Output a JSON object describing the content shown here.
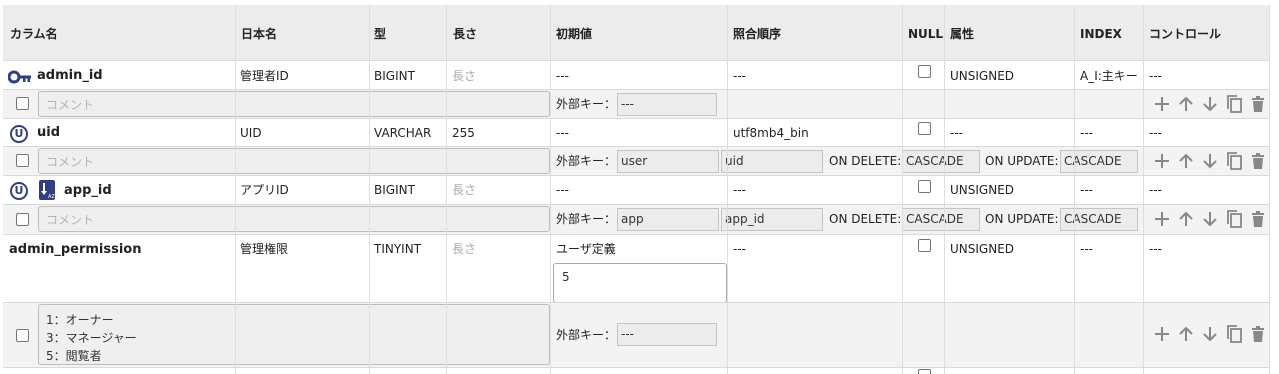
{
  "headers": {
    "column": "カラム名",
    "japanese": "日本名",
    "type": "型",
    "length": "長さ",
    "default": "初期値",
    "collation": "照合順序",
    "null": "NULL",
    "attribute": "属性",
    "index": "INDEX",
    "control": "コントロール"
  },
  "labels": {
    "comment_placeholder": "コメント",
    "length_placeholder": "長さ",
    "fk_label": "外部キー：",
    "on_delete": "ON DELETE:",
    "on_update": "ON UPDATE:"
  },
  "rows": [
    {
      "name": "admin_id",
      "jname": "管理者ID",
      "type": "BIGINT",
      "length": "",
      "default": "---",
      "collation": "---",
      "attribute": "UNSIGNED",
      "index": "A_I:主キー",
      "control": "---",
      "fk": {
        "table": "---"
      },
      "icons": [
        "key-icon"
      ]
    },
    {
      "name": "uid",
      "jname": "UID",
      "type": "VARCHAR",
      "length": "255",
      "default": "---",
      "collation": "utf8mb4_bin",
      "attribute": "---",
      "index": "---",
      "control": "---",
      "fk": {
        "table": "user",
        "column": "uid",
        "on_delete": "CASCADE",
        "on_update": "CASCADE"
      },
      "icons": [
        "unique-icon"
      ]
    },
    {
      "name": "app_id",
      "jname": "アプリID",
      "type": "BIGINT",
      "length": "",
      "default": "---",
      "collation": "---",
      "attribute": "UNSIGNED",
      "index": "---",
      "control": "---",
      "fk": {
        "table": "app",
        "column": "app_id",
        "on_delete": "CASCADE",
        "on_update": "CASCADE"
      },
      "icons": [
        "unique-icon",
        "index-icon"
      ]
    },
    {
      "name": "admin_permission",
      "jname": "管理権限",
      "type": "TINYINT",
      "length": "",
      "default": "ユーザ定義",
      "default_value": "5",
      "collation": "---",
      "attribute": "UNSIGNED",
      "index": "---",
      "control": "---",
      "comment": "1：オーナー\n3：マネージャー\n5：閲覧者",
      "fk": {
        "table": "---"
      },
      "icons": []
    }
  ],
  "icon_glyphs": {
    "unique-icon": "U",
    "index-icon": "AZ"
  },
  "colors": {
    "icon_blue": "#2e3f86",
    "header_bg": "#ececec",
    "sub_row_bg": "#f3f3f3",
    "control_icon": "#888888"
  }
}
